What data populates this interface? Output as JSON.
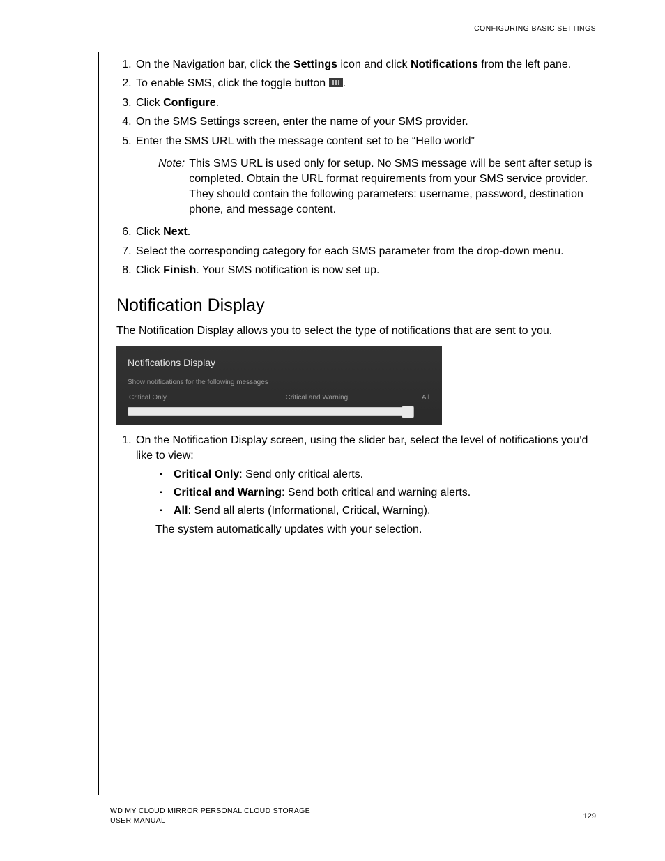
{
  "header": "CONFIGURING BASIC SETTINGS",
  "steps_a": {
    "s1_a": "On the Navigation bar, click the ",
    "s1_b": "Settings",
    "s1_c": " icon and click ",
    "s1_d": "Notifications",
    "s1_e": " from the left pane.",
    "s2_a": "To enable SMS, click the toggle button ",
    "s2_b": ".",
    "s3_a": "Click ",
    "s3_b": "Configure",
    "s3_c": ".",
    "s4": "On the SMS Settings screen, enter the name of your SMS provider.",
    "s5": "Enter the SMS URL with the message content set to be “Hello world”"
  },
  "note": {
    "label": "Note:",
    "body": "This SMS URL is used only for setup. No SMS message will be sent after setup is completed. Obtain the URL format requirements from your SMS service provider. They should contain the following parameters: username, password, destination phone, and message content."
  },
  "steps_b": {
    "s6_a": "Click ",
    "s6_b": "Next",
    "s6_c": ".",
    "s7": "Select the corresponding category for each SMS parameter from the drop-down menu.",
    "s8_a": "Click ",
    "s8_b": "Finish",
    "s8_c": ". Your SMS notification is now set up."
  },
  "section_title": "Notification Display",
  "intro": "The Notification Display allows you to select the type of notifications that are sent to you.",
  "panel": {
    "title": "Notifications Display",
    "sub": "Show notifications for the following messages",
    "opt_left": "Critical Only",
    "opt_mid": "Critical and Warning",
    "opt_right": "All"
  },
  "steps_c": {
    "s1": "On the Notification Display screen, using the slider bar, select the level of notifications you’d like to view:"
  },
  "bullets": {
    "b1_a": "Critical Only",
    "b1_b": ": Send only critical alerts.",
    "b2_a": "Critical and Warning",
    "b2_b": ": Send both critical and warning alerts.",
    "b3_a": "All",
    "b3_b": ": Send all alerts (Informational, Critical, Warning)."
  },
  "after_bullets": "The system automatically updates with your selection.",
  "footer": {
    "line1": "WD MY CLOUD MIRROR PERSONAL CLOUD STORAGE",
    "line2": "USER MANUAL",
    "page": "129"
  }
}
